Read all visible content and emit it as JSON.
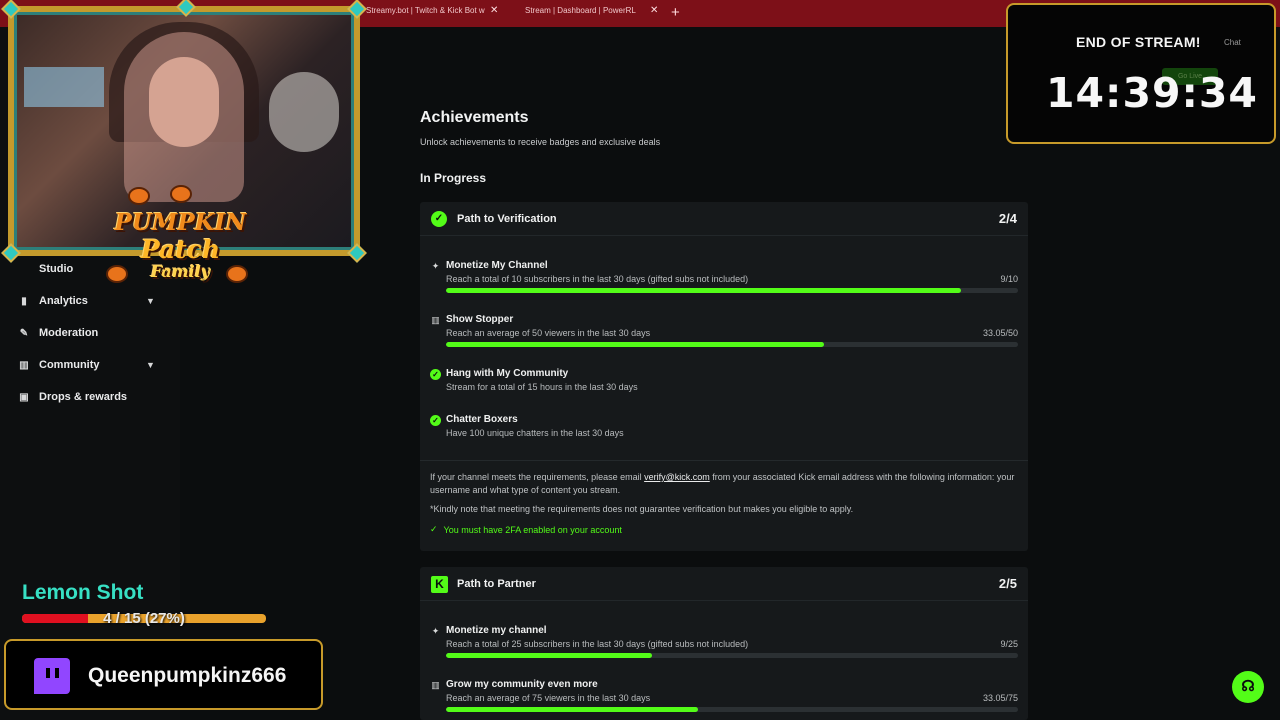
{
  "browser": {
    "tabs": [
      {
        "label": "Streamy.bot | Twitch & Kick Bot w",
        "close": "✕"
      },
      {
        "label": "Stream | Dashboard | PowerRL",
        "close": "✕"
      }
    ],
    "new_tab": "+"
  },
  "sidebar": {
    "items": [
      {
        "label": "Studio",
        "icon": "studio-icon"
      },
      {
        "label": "Analytics",
        "icon": "analytics-icon",
        "expandable": true
      },
      {
        "label": "Moderation",
        "icon": "wrench-icon"
      },
      {
        "label": "Community",
        "icon": "community-icon",
        "expandable": true
      },
      {
        "label": "Drops & rewards",
        "icon": "gift-icon"
      }
    ]
  },
  "overlay_logo": {
    "line1": "PUMPKIN",
    "line2": "Patch",
    "line3": "Family"
  },
  "main": {
    "title": "Achievements",
    "subtitle": "Unlock achievements to receive badges and exclusive deals",
    "section": "In Progress",
    "verification": {
      "name": "Path to Verification",
      "count": "2/4",
      "requirements": [
        {
          "title": "Monetize My Channel",
          "desc": "Reach a total of 10 subscribers in the last 30 days (gifted subs not included)",
          "value": "9/10",
          "progress": 0.9
        },
        {
          "title": "Show Stopper",
          "desc": "Reach an average of 50 viewers in the last 30 days",
          "value": "33.05/50",
          "progress": 0.661
        },
        {
          "title": "Hang with My Community",
          "desc": "Stream for a total of 15 hours in the last 30 days",
          "done": true
        },
        {
          "title": "Chatter Boxers",
          "desc": "Have 100 unique chatters in the last 30 days",
          "done": true
        }
      ],
      "note_pre": "If your channel meets the requirements, please email ",
      "note_email": "verify@kick.com",
      "note_post": " from your associated Kick email address with the following information: your username and what type of content you stream.",
      "disclaimer": "*Kindly note that meeting the requirements does not guarantee verification but makes you eligible to apply.",
      "twofa": "You must have 2FA enabled on your account"
    },
    "partner": {
      "name": "Path to Partner",
      "count": "2/5",
      "requirements": [
        {
          "title": "Monetize my channel",
          "desc": "Reach a total of 25 subscribers in the last 30 days (gifted subs not included)",
          "value": "9/25",
          "progress": 0.36
        },
        {
          "title": "Grow my community even more",
          "desc": "Reach an average of 75 viewers in the last 30 days",
          "value": "33.05/75",
          "progress": 0.44
        }
      ]
    }
  },
  "timer": {
    "label": "END OF STREAM!",
    "time": "14:39:34",
    "chat": "Chat",
    "go_live": "Go Live"
  },
  "sub_goal": {
    "name": "Lemon Shot",
    "text": "4 / 15 (27%)",
    "progress": 0.27
  },
  "twitch": {
    "username": "Queenpumpkinz666"
  },
  "colors": {
    "accent": "#53fc18",
    "tabbar": "#7d1018",
    "frame": "#c79a2a"
  }
}
